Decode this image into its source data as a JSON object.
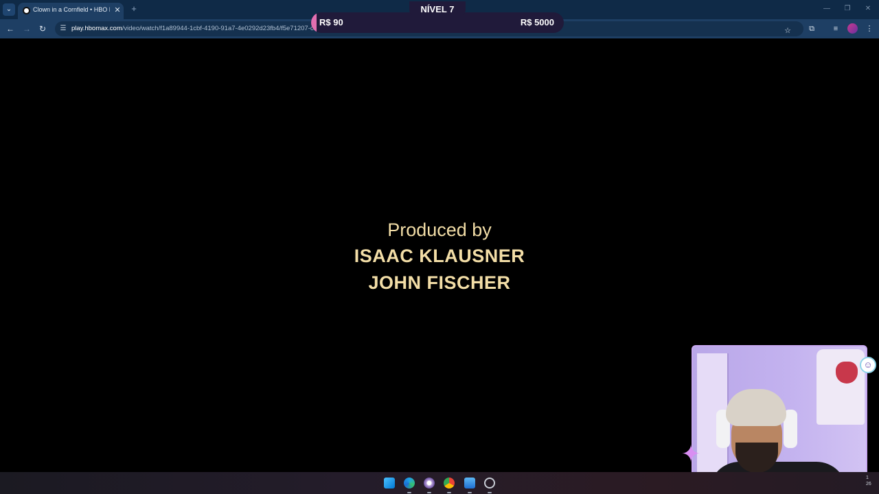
{
  "browser": {
    "tab_title": "Clown in a Cornfield • HBO Ma",
    "url_host": "play.hbomax.com",
    "url_path": "/video/watch/f1a89944-1cbf-4190-91a7-4e0292d23fb4/f5e71207-c",
    "icons": {
      "tab_search": "chevron-down-icon",
      "tab_close": "close-icon",
      "new_tab": "plus-icon",
      "back": "arrow-left-icon",
      "forward": "arrow-right-icon",
      "reload": "reload-icon",
      "site_info": "tune-icon",
      "bookmark": "star-icon",
      "extensions": "puzzle-icon",
      "media": "playlist-icon",
      "menu": "kebab-menu-icon"
    }
  },
  "overlay": {
    "level_label": "NÍVEL 7",
    "current_amount": "R$ 90",
    "target_amount": "R$ 5000",
    "progress_fraction": 0.018,
    "accent_color": "#e26fb0"
  },
  "video": {
    "credit_role": "Produced by",
    "credit_names": [
      "ISAAC KLAUSNER",
      "JOHN FISCHER"
    ],
    "text_color": "#f3dea7"
  },
  "taskbar": {
    "apps": [
      "windows-start-icon",
      "edge-icon",
      "app-icon",
      "chrome-icon",
      "photos-icon",
      "recorder-icon"
    ],
    "clock_fragment": [
      "1",
      "26"
    ]
  },
  "webcam": {
    "border_color": "#c9a9f2"
  }
}
